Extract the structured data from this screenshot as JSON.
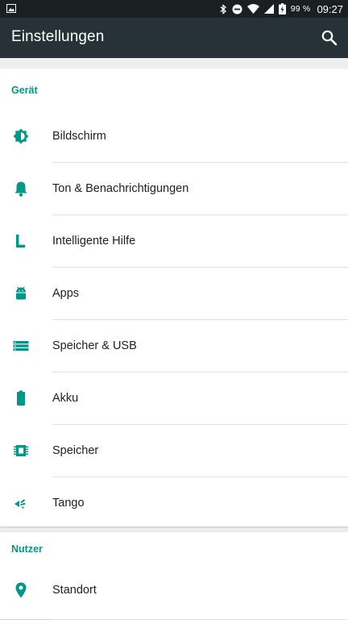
{
  "status_bar": {
    "battery_percent": "99 %",
    "time": "09:27",
    "icons": [
      "gallery-notification-icon",
      "bluetooth-icon",
      "do-not-disturb-icon",
      "wifi-icon",
      "cellular-signal-icon",
      "battery-charging-icon"
    ]
  },
  "app_bar": {
    "title": "Einstellungen",
    "search_icon": "search-icon"
  },
  "colors": {
    "accent": "#009688",
    "app_bar": "#263238",
    "status_bar": "#1a1f22",
    "background": "#eeeeee"
  },
  "sections": {
    "device": {
      "header": "Gerät",
      "items": [
        {
          "label": "Bildschirm",
          "icon": "brightness-icon"
        },
        {
          "label": "Ton & Benachrichtigungen",
          "icon": "bell-icon"
        },
        {
          "label": "Intelligente Hilfe",
          "icon": "smart-assist-icon"
        },
        {
          "label": "Apps",
          "icon": "android-icon"
        },
        {
          "label": "Speicher & USB",
          "icon": "storage-icon"
        },
        {
          "label": "Akku",
          "icon": "battery-icon"
        },
        {
          "label": "Speicher",
          "icon": "memory-icon"
        },
        {
          "label": "Tango",
          "icon": "tango-icon"
        }
      ]
    },
    "user": {
      "header": "Nutzer",
      "items": [
        {
          "label": "Standort",
          "icon": "location-pin-icon"
        }
      ]
    }
  }
}
